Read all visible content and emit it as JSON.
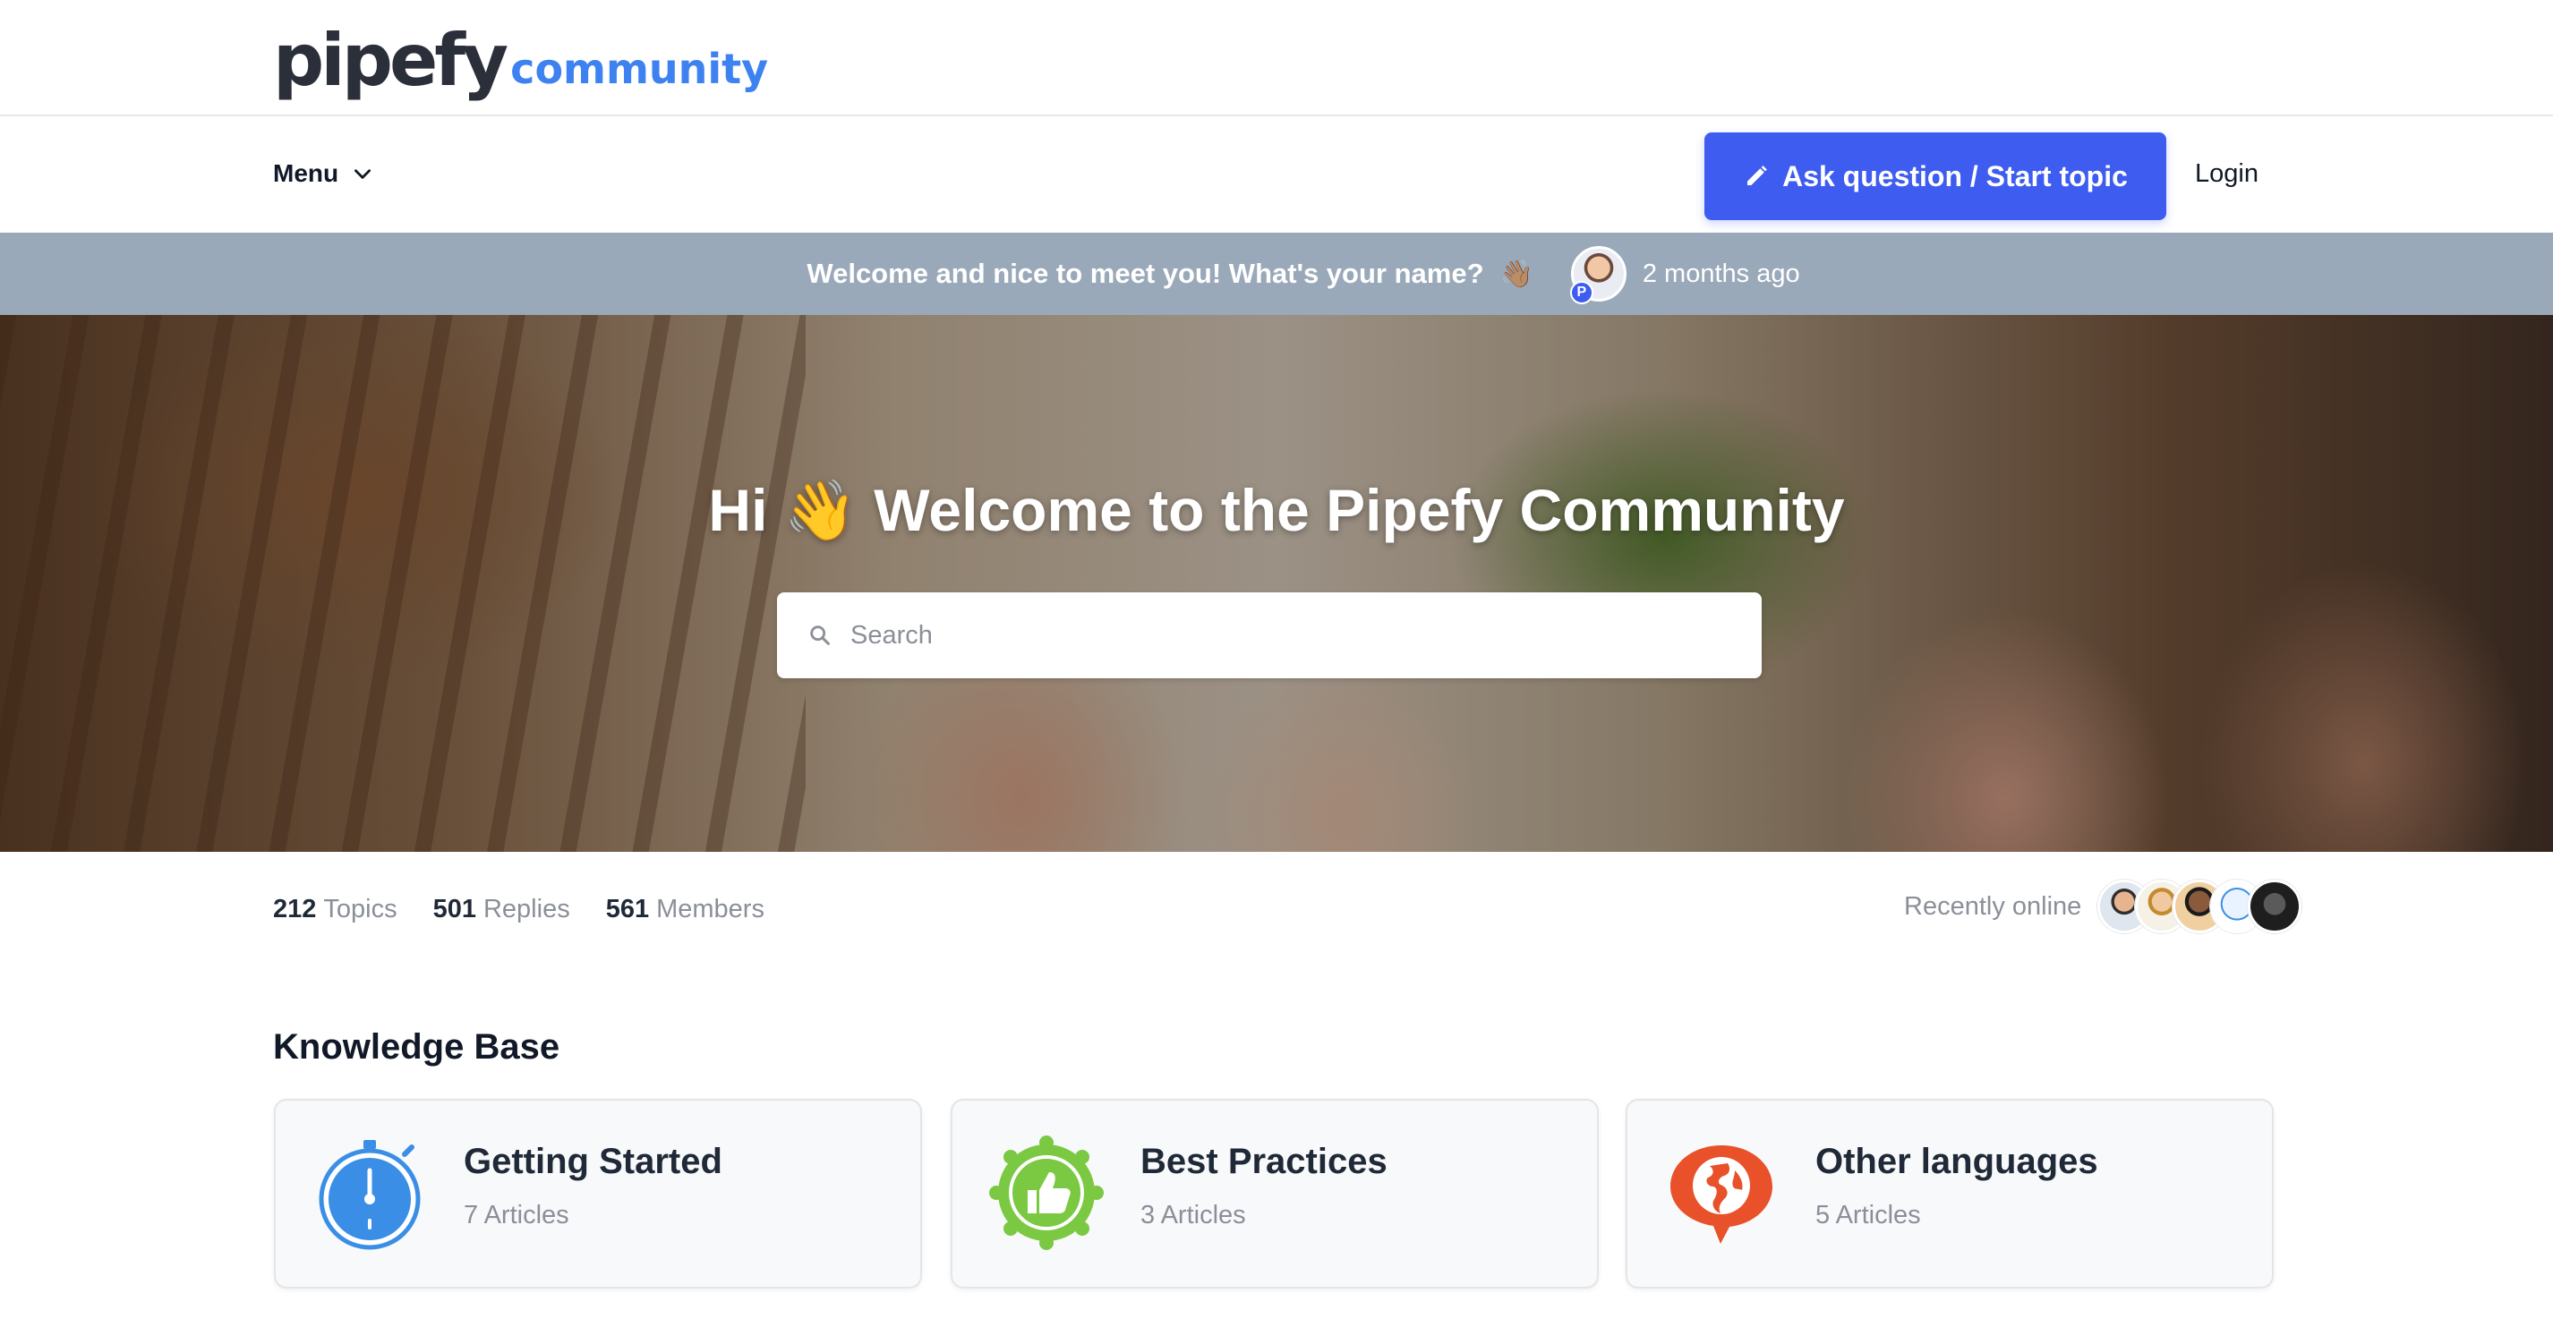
{
  "brand": {
    "logo_main": "pipefy",
    "logo_sub": "community"
  },
  "nav": {
    "menu_label": "Menu",
    "ask_label": "Ask question / Start topic",
    "login_label": "Login"
  },
  "announcement": {
    "text": "Welcome and nice to meet you! What's your name?",
    "emoji": "👋🏽",
    "avatar_badge": "P",
    "time": "2 months ago"
  },
  "hero": {
    "greeting": "Hi",
    "wave": "👋",
    "title": "Welcome to the Pipefy Community",
    "search_placeholder": "Search"
  },
  "stats": {
    "topics_count": "212",
    "topics_label": "Topics",
    "replies_count": "501",
    "replies_label": "Replies",
    "members_count": "561",
    "members_label": "Members",
    "recently_online_label": "Recently online"
  },
  "knowledge_base": {
    "title": "Knowledge Base",
    "cards": [
      {
        "name": "Getting Started",
        "count": "7 Articles",
        "icon": "stopwatch-icon"
      },
      {
        "name": "Best Practices",
        "count": "3 Articles",
        "icon": "thumbs-up-badge-icon"
      },
      {
        "name": "Other languages",
        "count": "5 Articles",
        "icon": "globe-speech-icon"
      }
    ]
  },
  "colors": {
    "accent": "#3e5cf0",
    "brand_blue": "#3d82f0",
    "announce_bg": "#9aa9b9",
    "stopwatch_blue": "#3a8ee6",
    "badge_green": "#7bc843",
    "globe_orange": "#e8512a"
  }
}
